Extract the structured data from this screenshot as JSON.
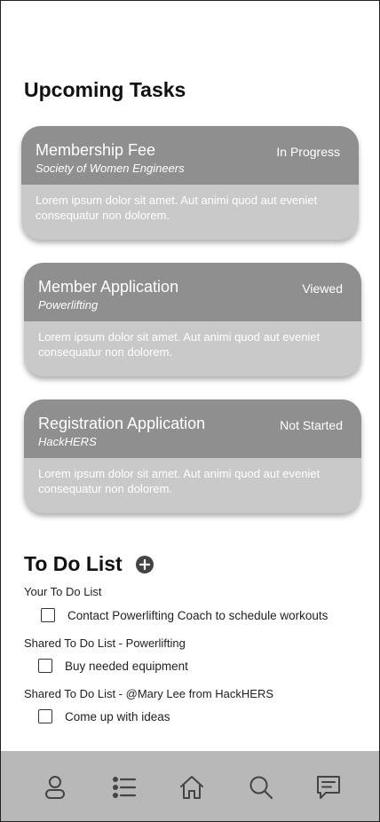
{
  "upcoming": {
    "title": "Upcoming Tasks",
    "cards": [
      {
        "title": "Membership Fee",
        "subtitle": "Society of Women Engineers",
        "status": "In Progress",
        "body": "Lorem ipsum dolor sit amet. Aut animi quod aut eveniet consequatur non dolorem."
      },
      {
        "title": "Member Application",
        "subtitle": "Powerlifting",
        "status": "Viewed",
        "body": "Lorem ipsum dolor sit amet. Aut animi quod aut eveniet consequatur non dolorem."
      },
      {
        "title": "Registration Application",
        "subtitle": "HackHERS",
        "status": "Not Started",
        "body": "Lorem ipsum dolor sit amet. Aut animi quod aut eveniet consequatur non dolorem."
      }
    ]
  },
  "todo": {
    "title": "To Do List",
    "add_icon": "plus-circle-icon",
    "groups": [
      {
        "label": "Your To Do List",
        "items": [
          "Contact Powerlifting Coach to schedule workouts"
        ]
      },
      {
        "label": "Shared To Do List - Powerlifting",
        "items": [
          "Buy needed equipment"
        ]
      },
      {
        "label": "Shared To Do List - @Mary Lee from HackHERS",
        "items": [
          "Come up with ideas"
        ]
      }
    ]
  },
  "nav": {
    "icons": [
      "profile-icon",
      "list-icon",
      "home-icon",
      "search-icon",
      "chat-icon"
    ]
  },
  "colors": {
    "card_header": "#8f8f8f",
    "card_body": "#c9c9c9",
    "nav_bar": "#b8b8b8",
    "icon_stroke": "#444444"
  }
}
